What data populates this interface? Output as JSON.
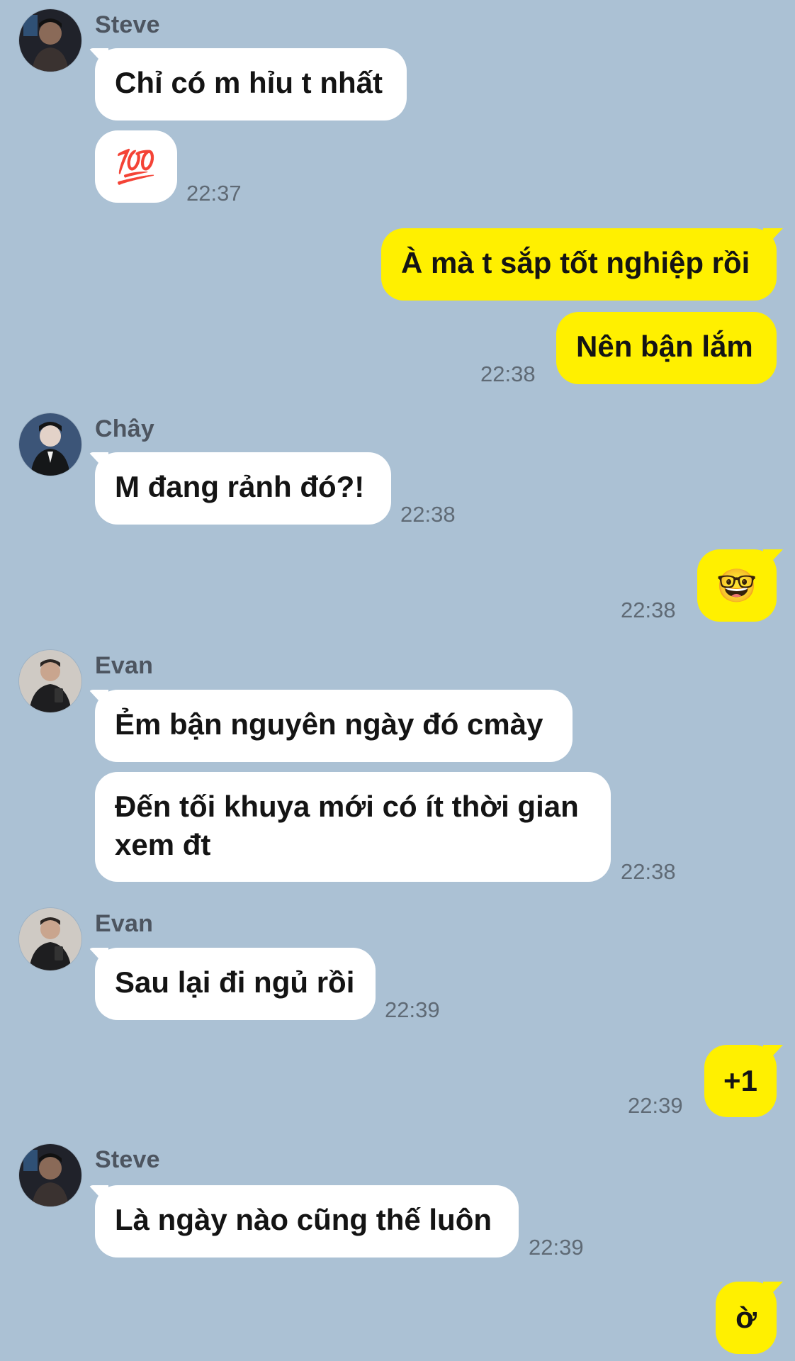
{
  "chat": {
    "messages": [
      {
        "sender": "Steve",
        "avatar_icon": "steve-avatar",
        "texts": [
          "Chỉ có m hỉu t nhất",
          "💯"
        ],
        "time": "22:37"
      },
      {
        "sender": "me",
        "texts": [
          "À mà t sắp tốt nghiệp rồi",
          "Nên bận lắm"
        ],
        "time": "22:38"
      },
      {
        "sender": "Chây",
        "avatar_icon": "chay-avatar",
        "texts": [
          "M đang rảnh đó?!"
        ],
        "time": "22:38"
      },
      {
        "sender": "me",
        "texts": [
          "🤓"
        ],
        "time": "22:38"
      },
      {
        "sender": "Evan",
        "avatar_icon": "evan-avatar",
        "texts": [
          "Ẻm bận nguyên ngày đó cmày",
          "Đến tối khuya mới có ít thời gian",
          "xem đt"
        ],
        "time": "22:38"
      },
      {
        "sender": "Evan",
        "avatar_icon": "evan-avatar",
        "texts": [
          "Sau lại đi ngủ rồi"
        ],
        "time": "22:39"
      },
      {
        "sender": "me",
        "texts": [
          "+1"
        ],
        "time": "22:39"
      },
      {
        "sender": "Steve",
        "avatar_icon": "steve-avatar",
        "texts": [
          "Là ngày nào cũng thế luôn"
        ],
        "time": "22:39"
      },
      {
        "sender": "me",
        "texts": [
          "ờ"
        ],
        "time": ""
      }
    ]
  },
  "colors": {
    "background": "#abc1d4",
    "incoming_bubble": "#ffffff",
    "outgoing_bubble": "#fff000",
    "time_text": "#5f6a75"
  }
}
